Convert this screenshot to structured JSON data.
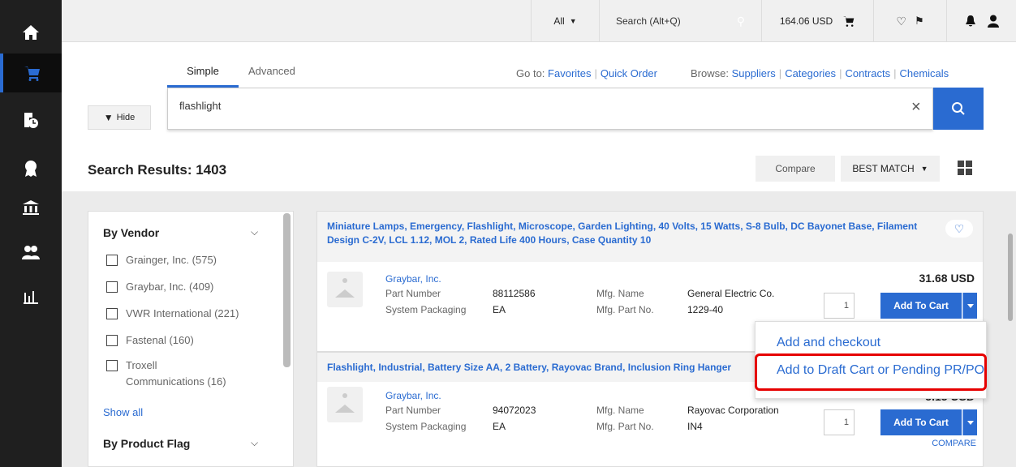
{
  "topbar": {
    "scope": "All",
    "search_placeholder": "Search (Alt+Q)",
    "cart_total": "164.06 USD"
  },
  "search": {
    "tabs": [
      {
        "label": "Simple"
      },
      {
        "label": "Advanced"
      }
    ],
    "goto_label": "Go to:",
    "goto_links": [
      "Favorites",
      "Quick Order"
    ],
    "browse_label": "Browse:",
    "browse_links": [
      "Suppliers",
      "Categories",
      "Contracts",
      "Chemicals"
    ],
    "query": "flashlight",
    "hide_label": "Hide"
  },
  "results": {
    "title": "Search Results: 1403",
    "compare_label": "Compare",
    "sort_label": "BEST MATCH"
  },
  "filters": {
    "vendor_heading": "By Vendor",
    "vendors": [
      {
        "label": "Grainger, Inc. (575)"
      },
      {
        "label": "Graybar, Inc. (409)"
      },
      {
        "label": "VWR International (221)"
      },
      {
        "label": "Fastenal (160)"
      },
      {
        "label": "Troxell Communications (16)"
      }
    ],
    "show_all": "Show all",
    "flag_heading": "By Product Flag"
  },
  "products": [
    {
      "title": "Miniature Lamps, Emergency, Flashlight, Microscope, Garden Lighting, 40 Volts, 15 Watts, S-8 Bulb, DC Bayonet Base, Filament Design C-2V, LCL 1.12, MOL 2, Rated Life 400 Hours, Case Quantity 10",
      "vendor": "Graybar, Inc.",
      "part_number_label": "Part Number",
      "part_number": "88112586",
      "packaging_label": "System Packaging",
      "packaging": "EA",
      "mfg_name_label": "Mfg. Name",
      "mfg_name": "General Electric Co.",
      "mfg_part_label": "Mfg. Part No.",
      "mfg_part": "1229-40",
      "price": "31.68 USD",
      "qty": "1",
      "add_label": "Add To Cart"
    },
    {
      "title": "Flashlight, Industrial, Battery Size AA, 2 Battery, Rayovac Brand, Inclusion Ring Hanger",
      "vendor": "Graybar, Inc.",
      "part_number_label": "Part Number",
      "part_number": "94072023",
      "packaging_label": "System Packaging",
      "packaging": "EA",
      "mfg_name_label": "Mfg. Name",
      "mfg_name": "Rayovac Corporation",
      "mfg_part_label": "Mfg. Part No.",
      "mfg_part": "IN4",
      "price": "5.15 USD",
      "qty": "1",
      "add_label": "Add To Cart",
      "compare_label": "COMPARE"
    }
  ],
  "cart_menu": {
    "items": [
      {
        "label": "Add and checkout"
      },
      {
        "label": "Add to Draft Cart or Pending PR/PO"
      }
    ]
  },
  "colors": {
    "accent": "#2a6bd1",
    "sidebar": "#1f1f1f",
    "highlight": "#e60000"
  }
}
